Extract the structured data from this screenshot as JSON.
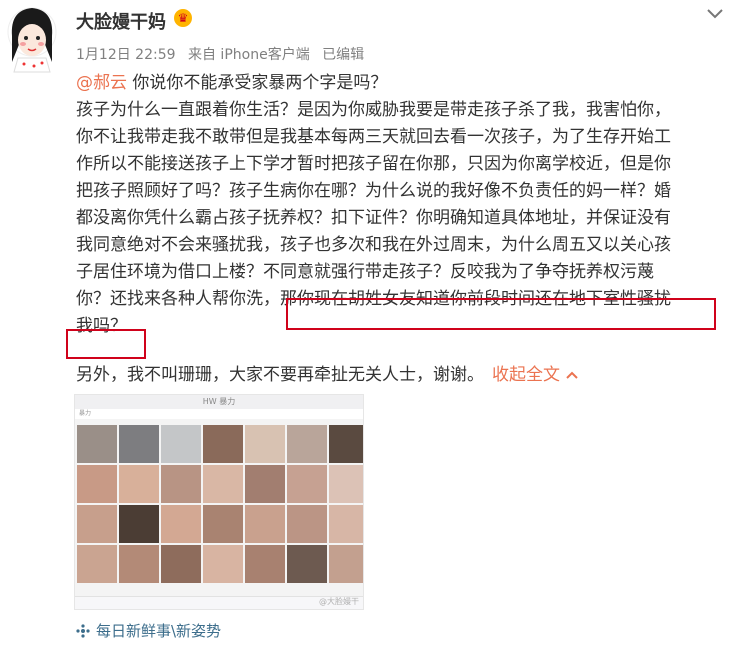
{
  "author": {
    "name": "大脸嫚干妈",
    "badge": "♛"
  },
  "meta": {
    "time": "1月12日 22:59",
    "source": "来自 iPhone客户端",
    "edited": "已编辑"
  },
  "post": {
    "mention": "@郝云",
    "line1_rest": " 你说你不能承受家暴两个字是吗？",
    "lines": [
      "孩子为什么一直跟着你生活？是因为你威胁我要是带走孩子杀了我，我害怕你，",
      "你不让我带走我不敢带但是我基本每两三天就回去看一次孩子，为了生存开始工",
      "作所以不能接送孩子上下学才暂时把孩子留在你那，只因为你离学校近，但是你",
      "把孩子照顾好了吗？孩子生病你在哪？为什么说的我好像不负责任的妈一样？婚",
      "都没离你凭什么霸占孩子抚养权？扣下证件？你明确知道具体地址，并保证没有",
      "我同意绝对不会来骚扰我，孩子也多次和我在外过周末，为什么周五又以关心孩",
      "子居住环境为借口上楼？不同意就强行带走孩子？反咬我为了争夺抚养权污蔑"
    ],
    "line9_plain": "你？还找来各种人帮你洗，",
    "line9_highlight": "那你现在胡姓女友知道你前段时间还在地下室性骚扰",
    "line10_highlight": "我吗？",
    "extra": "另外，我不叫珊珊，大家不要再牵扯无关人士，谢谢。",
    "collapse_label": "收起全文"
  },
  "screenshot": {
    "title": "HW 暴力",
    "subtitle": "暴力",
    "watermark": "@大脸嫚干"
  },
  "footer": {
    "topic": "每日新鲜事\\新姿势"
  }
}
